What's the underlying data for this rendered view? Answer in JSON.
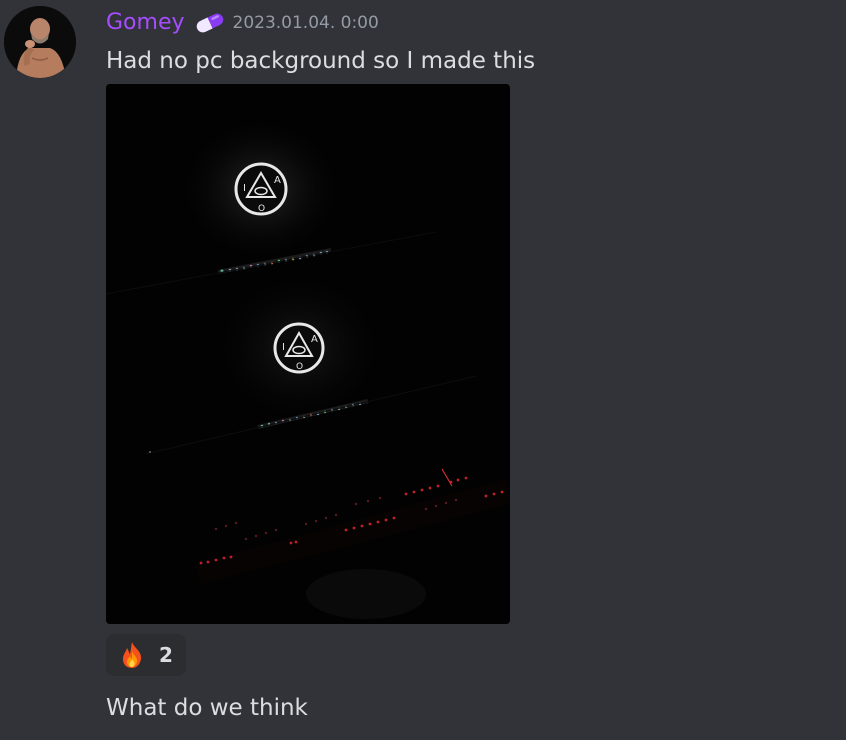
{
  "message": {
    "author": {
      "username": "Gomey",
      "username_color": "#a64dff",
      "role_icon": "pill-icon"
    },
    "timestamp": "2023.01.04. 0:00",
    "text": "Had no pc background so I made this",
    "attachment": {
      "type": "image",
      "description_icons": [
        "circle-triangle-eye-symbol",
        "keyboard-backlight"
      ]
    },
    "reactions": [
      {
        "emoji": "fire-emoji",
        "count": "2"
      }
    ]
  },
  "next_message": {
    "text": "What do we think"
  },
  "colors": {
    "background": "#313338",
    "text": "#dbdee1",
    "timestamp": "#949ba4",
    "reaction_bg": "#2b2d31"
  }
}
